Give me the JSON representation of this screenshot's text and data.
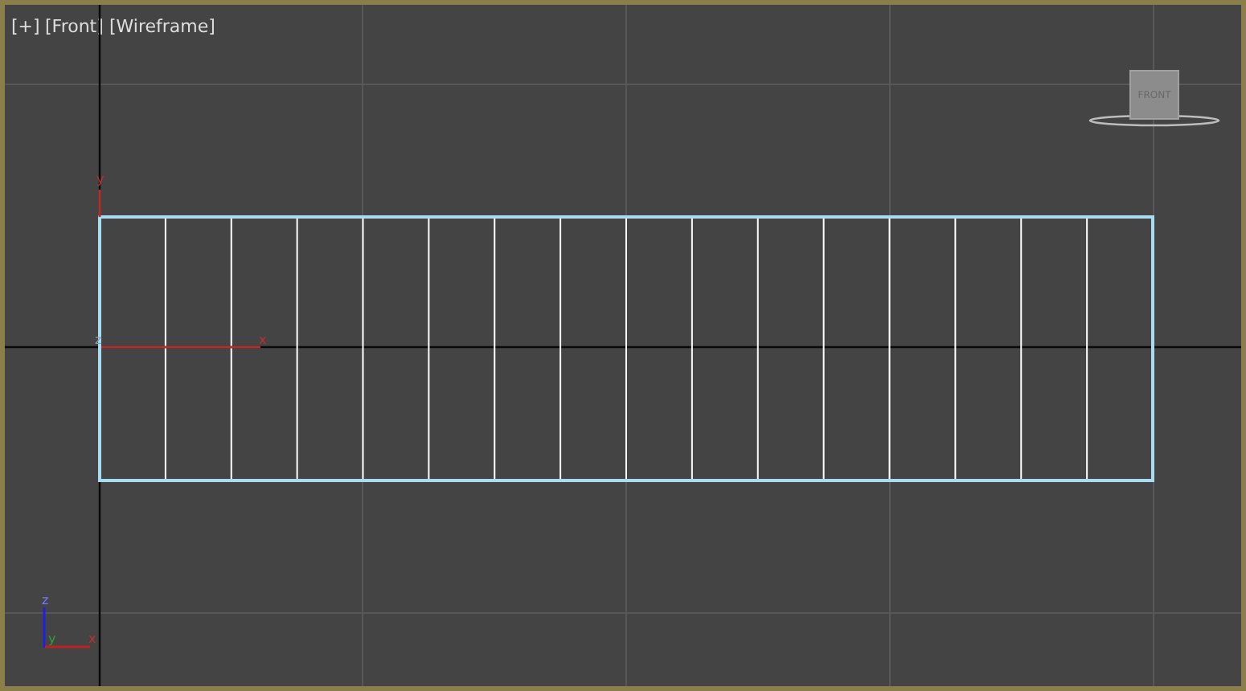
{
  "viewport": {
    "menus": [
      {
        "label": "[+]"
      },
      {
        "label": "[Front]"
      },
      {
        "label": "[Wireframe]"
      }
    ],
    "viewcube": {
      "face": "FRONT"
    },
    "gizmo_axes": {
      "vertical": "y",
      "origin": "z",
      "horizontal": "x"
    },
    "axis_tripod": {
      "up": "z",
      "center": "y",
      "right": "x"
    }
  }
}
